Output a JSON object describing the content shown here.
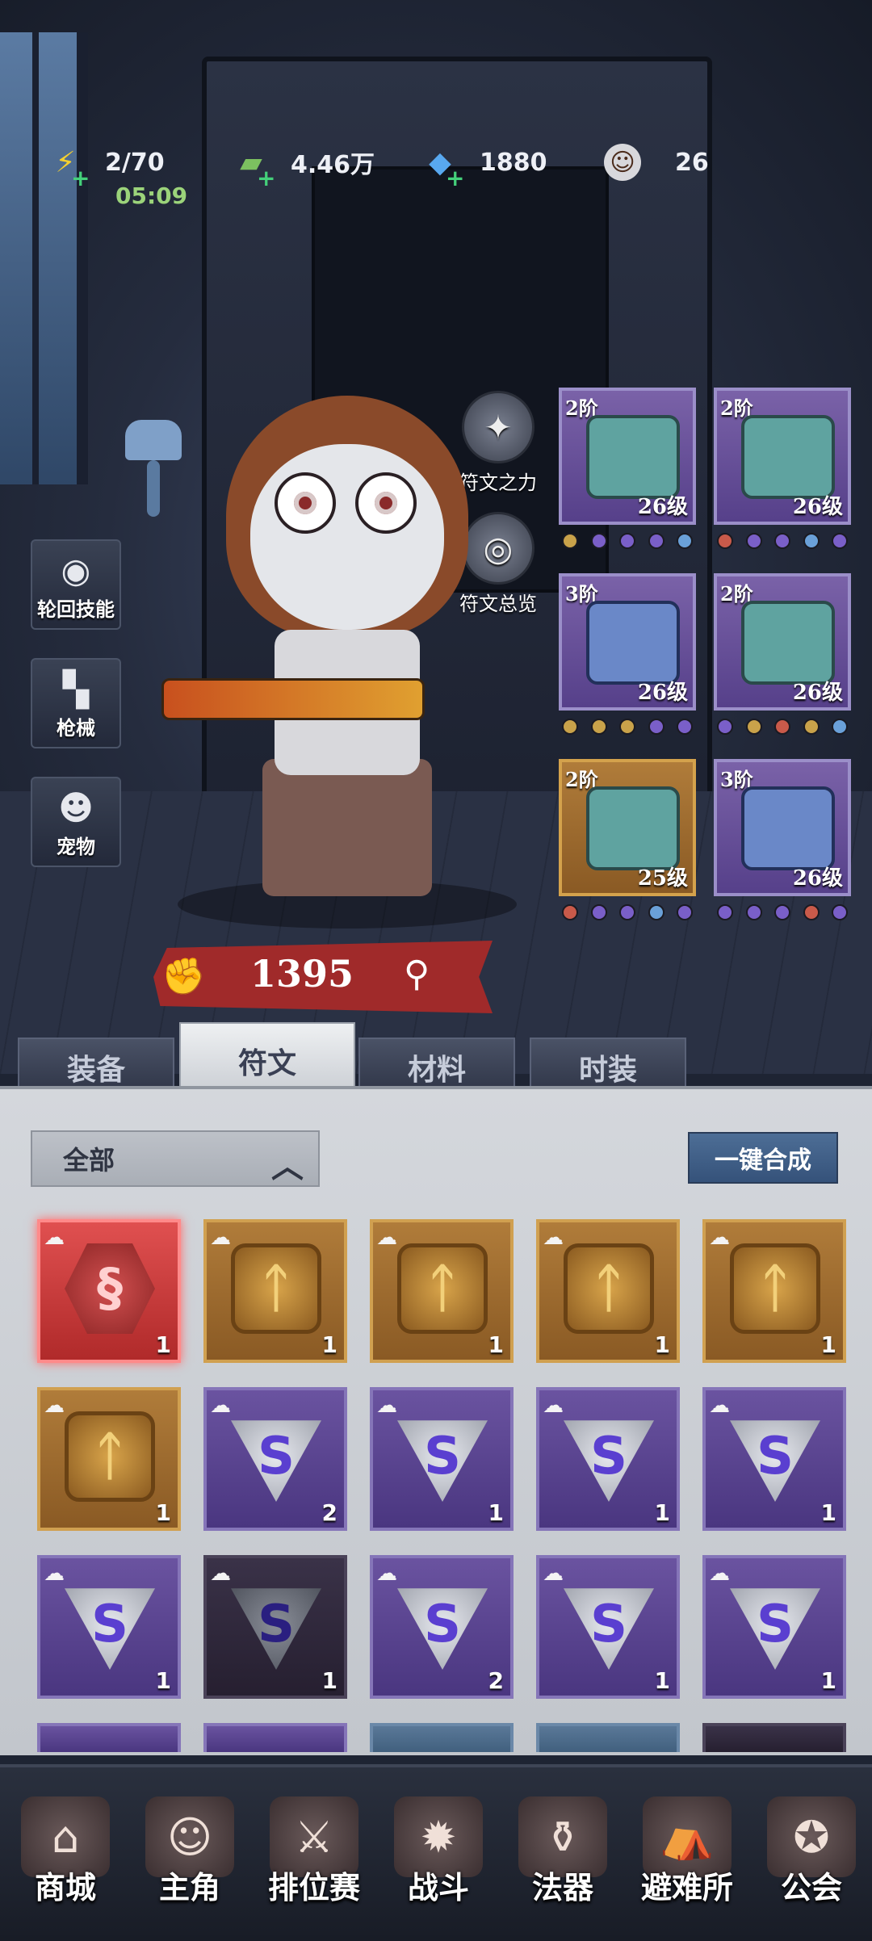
{
  "top_bar": {
    "energy": {
      "value": "2/70",
      "timer": "05:09",
      "icon": "lightning-icon"
    },
    "cash": {
      "value": "4.46万",
      "icon": "cash-stack-icon"
    },
    "diamond": {
      "value": "1880",
      "icon": "diamond-icon"
    },
    "player": {
      "value": "26",
      "icon": "player-avatar-icon"
    }
  },
  "side_buttons": [
    {
      "label": "轮回技能",
      "icon": "eye-swirl-icon"
    },
    {
      "label": "枪械",
      "icon": "revolver-icon"
    },
    {
      "label": "宠物",
      "icon": "pet-face-icon"
    }
  ],
  "rune_buttons": [
    {
      "label": "符文之力",
      "icon": "rune-power-icon"
    },
    {
      "label": "符文总览",
      "icon": "rune-overview-icon"
    }
  ],
  "power": {
    "value": "1395",
    "icon": "fist-icon",
    "search_icon": "magnifier-icon"
  },
  "equipment": [
    {
      "tier": "2阶",
      "level": "26级",
      "item": "cap",
      "frame": "purple",
      "dots": [
        "#c9a24a",
        "#7a5fc8",
        "#7a5fc8",
        "#7a5fc8",
        "#6aa0d8"
      ]
    },
    {
      "tier": "2阶",
      "level": "26级",
      "item": "scarf",
      "frame": "purple",
      "dots": [
        "#c95a4a",
        "#7a5fc8",
        "#7a5fc8",
        "#6aa0d8",
        "#7a5fc8"
      ]
    },
    {
      "tier": "3阶",
      "level": "26级",
      "item": "jacket",
      "frame": "purple",
      "dots": [
        "#c9a24a",
        "#c9a24a",
        "#c9a24a",
        "#7a5fc8",
        "#7a5fc8"
      ]
    },
    {
      "tier": "2阶",
      "level": "26级",
      "item": "pants",
      "frame": "purple",
      "dots": [
        "#7a5fc8",
        "#c9a24a",
        "#c95a4a",
        "#c9a24a",
        "#6aa0d8"
      ]
    },
    {
      "tier": "2阶",
      "level": "25级",
      "item": "shoes",
      "frame": "gold",
      "dots": [
        "#c95a4a",
        "#7a5fc8",
        "#7a5fc8",
        "#6aa0d8",
        "#7a5fc8"
      ]
    },
    {
      "tier": "3阶",
      "level": "26级",
      "item": "glove",
      "frame": "purple",
      "dots": [
        "#7a5fc8",
        "#7a5fc8",
        "#7a5fc8",
        "#c95a4a",
        "#7a5fc8"
      ]
    }
  ],
  "tabs": [
    {
      "label": "装备",
      "active": false
    },
    {
      "label": "符文",
      "active": true
    },
    {
      "label": "材料",
      "active": false
    },
    {
      "label": "时装",
      "active": false
    }
  ],
  "filter": {
    "label": "全部",
    "icon": "chevron-up-icon"
  },
  "synth_button": "一键合成",
  "runes": [
    {
      "type": "red",
      "symbol": "§",
      "count": "1"
    },
    {
      "type": "gold",
      "symbol": "ᛏ",
      "count": "1"
    },
    {
      "type": "gold",
      "symbol": "ᛏ",
      "count": "1"
    },
    {
      "type": "gold",
      "symbol": "ᛏ",
      "count": "1"
    },
    {
      "type": "gold",
      "symbol": "ᛏ",
      "count": "1"
    },
    {
      "type": "gold",
      "symbol": "ᛏ",
      "count": "1"
    },
    {
      "type": "purple",
      "symbol": "S",
      "count": "2"
    },
    {
      "type": "purple",
      "symbol": "S",
      "count": "1"
    },
    {
      "type": "purple",
      "symbol": "S",
      "count": "1"
    },
    {
      "type": "purple",
      "symbol": "S",
      "count": "1"
    },
    {
      "type": "purple",
      "symbol": "S",
      "count": "1"
    },
    {
      "type": "dark",
      "symbol": "S",
      "count": "1"
    },
    {
      "type": "purple",
      "symbol": "S",
      "count": "2"
    },
    {
      "type": "purple",
      "symbol": "S",
      "count": "1"
    },
    {
      "type": "purple",
      "symbol": "S",
      "count": "1"
    }
  ],
  "partial_runes": [
    "purple",
    "purple",
    "steel",
    "steel",
    "dark"
  ],
  "bottom_nav": [
    {
      "label": "商城",
      "icon": "shop-icon"
    },
    {
      "label": "主角",
      "icon": "hero-icon"
    },
    {
      "label": "排位赛",
      "icon": "ranked-icon"
    },
    {
      "label": "战斗",
      "icon": "battle-icon"
    },
    {
      "label": "法器",
      "icon": "artifact-icon"
    },
    {
      "label": "避难所",
      "icon": "shelter-icon"
    },
    {
      "label": "公会",
      "icon": "guild-icon"
    }
  ]
}
